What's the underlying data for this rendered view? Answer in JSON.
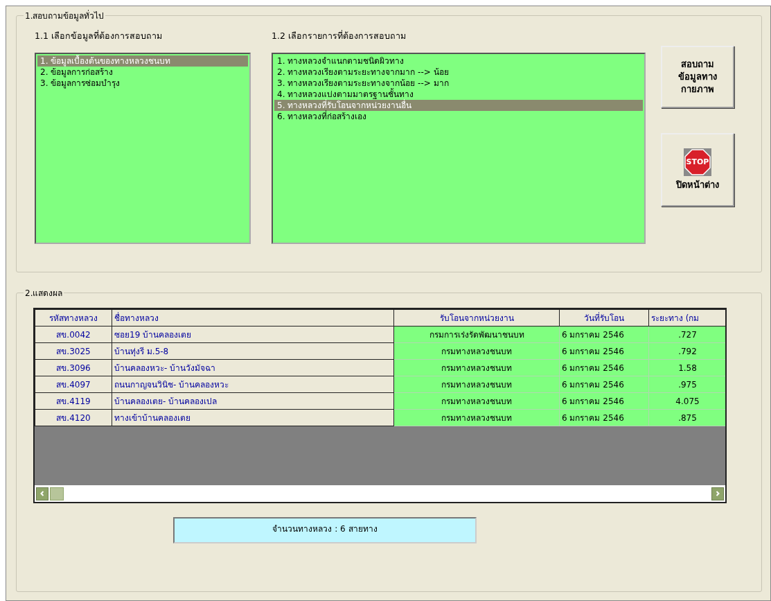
{
  "section1": {
    "title": "1.สอบถามข้อมูลทั่วไป",
    "list1": {
      "label": "1.1 เลือกข้อมูลที่ต้องการสอบถาม",
      "items": [
        {
          "text": "1. ข้อมูลเบื้องต้นของทางหลวงชนบท",
          "selected": true
        },
        {
          "text": "2. ข้อมูลการก่อสร้าง",
          "selected": false
        },
        {
          "text": "3. ข้อมูลการซ่อมบำรุง",
          "selected": false
        }
      ]
    },
    "list2": {
      "label": "1.2 เลือกรายการที่ต้องการสอบถาม",
      "items": [
        {
          "text": "1. ทางหลวงจำแนกตามชนิดผิวทาง",
          "selected": false
        },
        {
          "text": "2. ทางหลวงเรียงตามระยะทางจากมาก --> น้อย",
          "selected": false
        },
        {
          "text": "3. ทางหลวงเรียงตามระยะทางจากน้อย --> มาก",
          "selected": false
        },
        {
          "text": "4. ทางหลวงแบ่งตามมาตรฐานชั้นทาง",
          "selected": false
        },
        {
          "text": "5. ทางหลวงที่รับโอนจากหน่วยงานอื่น",
          "selected": true
        },
        {
          "text": "6. ทางหลวงที่ก่อสร้างเอง",
          "selected": false
        }
      ]
    },
    "query_button": {
      "lines": [
        "สอบถาม",
        "ข้อมูลทาง",
        "กายภาพ"
      ]
    },
    "close_button": {
      "icon_text": "STOP",
      "label": "ปิดหน้าต่าง"
    }
  },
  "section2": {
    "title": "2.แสดงผล",
    "table": {
      "columns": [
        {
          "label": "รหัสทางหลวง",
          "tinted": false
        },
        {
          "label": "ชื่อทางหลวง",
          "tinted": false
        },
        {
          "label": "รับโอนจากหน่วยงาน",
          "tinted": true
        },
        {
          "label": "วันที่รับโอน",
          "tinted": true
        },
        {
          "label": "ระยะทาง (กม",
          "tinted": true
        }
      ],
      "rows": [
        [
          "สข.0042",
          " ซอย19 บ้านคลองเตย",
          "กรมการเร่งรัดพัฒนาชนบท",
          "6 มกราคม 2546",
          ".727"
        ],
        [
          "สข.3025",
          "บ้านทุ่งรี ม.5-8",
          "กรมทางหลวงชนบท",
          "6 มกราคม 2546",
          ".792"
        ],
        [
          "สข.3096",
          "บ้านคลองหวะ- บ้านวังมัจฉา",
          "กรมทางหลวงชนบท",
          "6 มกราคม 2546",
          "1.58"
        ],
        [
          "สข.4097",
          "ถนนกาญจนวินิช- บ้านคลองหวะ",
          "กรมทางหลวงชนบท",
          "6 มกราคม 2546",
          ".975"
        ],
        [
          "สข.4119",
          "บ้านคลองเตย- บ้านคลองเปล",
          "กรมทางหลวงชนบท",
          "6 มกราคม 2546",
          "4.075"
        ],
        [
          "สข.4120",
          "ทางเข้าบ้านคลองเตย",
          "กรมทางหลวงชนบท",
          "6 มกราคม 2546",
          ".875"
        ]
      ]
    },
    "summary": "จำนวนทางหลวง : 6 สายทาง"
  }
}
